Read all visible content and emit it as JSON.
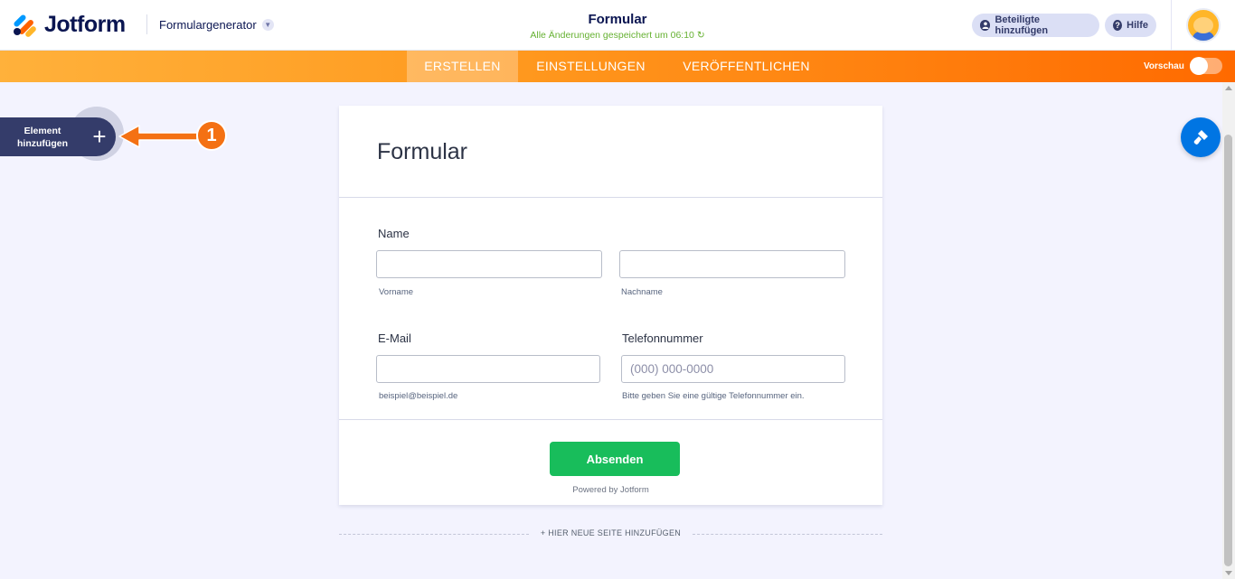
{
  "header": {
    "logo_text": "Jotform",
    "product_menu": "Formulargenerator",
    "form_title": "Formular",
    "save_status": "Alle Änderungen gespeichert um 06:10 ↻",
    "add_participants": "Beteiligte hinzufügen",
    "help": "Hilfe"
  },
  "nav": {
    "tabs": [
      {
        "label": "ERSTELLEN",
        "active": true
      },
      {
        "label": "EINSTELLUNGEN",
        "active": false
      },
      {
        "label": "VERÖFFENTLICHEN",
        "active": false
      }
    ],
    "preview_label": "Vorschau",
    "preview_on": false
  },
  "sidebar": {
    "add_element_label": "Element hinzufügen",
    "add_icon": "+"
  },
  "annotation": {
    "step_number": "1"
  },
  "form": {
    "heading": "Formular",
    "name_label": "Name",
    "first_name_sublabel": "Vorname",
    "last_name_sublabel": "Nachname",
    "email_label": "E-Mail",
    "email_sublabel": "beispiel@beispiel.de",
    "phone_label": "Telefonnummer",
    "phone_placeholder": "(000) 000-0000",
    "phone_sublabel": "Bitte geben Sie eine gültige Telefonnummer ein.",
    "submit_label": "Absenden",
    "powered_by": "Powered by Jotform"
  },
  "footer": {
    "add_page": "+ HIER NEUE SEITE HINZUFÜGEN"
  },
  "colors": {
    "accent_orange": "#ff6100",
    "submit_green": "#18bd5b",
    "navy": "#0a1551",
    "designer_blue": "#0075e3"
  },
  "icons": [
    "jotform-logo-icon",
    "chevron-down-icon",
    "user-icon",
    "help-icon",
    "plus-icon",
    "arrow-left-icon",
    "paint-roller-icon",
    "avatar"
  ]
}
